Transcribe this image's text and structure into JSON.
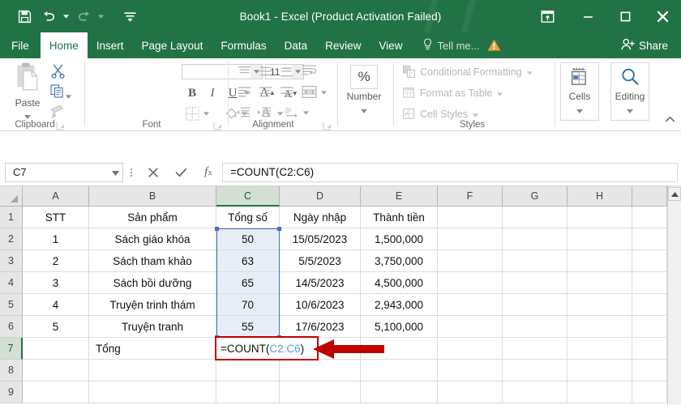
{
  "titlebar": {
    "document_title": "Book1 - Excel (Product Activation Failed)",
    "qat": [
      {
        "name": "save-icon",
        "label": "Save"
      },
      {
        "name": "undo-icon",
        "label": "Undo"
      },
      {
        "name": "redo-icon",
        "label": "Redo"
      },
      {
        "name": "customize-qat-icon",
        "label": "Customize Quick Access Toolbar"
      }
    ],
    "window_controls": [
      {
        "name": "ribbon-display-options-icon",
        "label": "Ribbon Display Options"
      },
      {
        "name": "minimize-icon",
        "label": "Minimize"
      },
      {
        "name": "restore-icon",
        "label": "Restore Down"
      },
      {
        "name": "close-icon",
        "label": "Close"
      }
    ]
  },
  "tabs": [
    {
      "label": "File",
      "active": false
    },
    {
      "label": "Home",
      "active": true
    },
    {
      "label": "Insert",
      "active": false
    },
    {
      "label": "Page Layout",
      "active": false
    },
    {
      "label": "Formulas",
      "active": false
    },
    {
      "label": "Data",
      "active": false
    },
    {
      "label": "Review",
      "active": false
    },
    {
      "label": "View",
      "active": false
    }
  ],
  "tellme": {
    "label": "Tell me...",
    "icon": "lightbulb-icon"
  },
  "warning": {
    "icon": "warning-triangle-icon",
    "color": "#e8a33d"
  },
  "share": {
    "label": "Share",
    "icon": "share-person-icon"
  },
  "ribbon": {
    "groups": [
      {
        "label": "Clipboard"
      },
      {
        "label": "Font"
      },
      {
        "label": "Alignment"
      },
      {
        "label": "Number"
      },
      {
        "label": "Styles"
      }
    ],
    "clipboard": {
      "paste_label": "Paste",
      "cut_label": "Cut",
      "copy_label": "Copy",
      "format_painter_label": "Format Painter"
    },
    "font": {
      "font_name_value": "",
      "font_name_placeholder": "",
      "font_size_value": "11",
      "bold_label": "B",
      "italic_label": "I",
      "underline_label": "U",
      "grow_font_label": "A",
      "shrink_font_label": "A",
      "borders_label": "Borders",
      "fill_color_label": "Fill Color",
      "font_color_label": "A"
    },
    "number": {
      "label": "Number",
      "format_icon": "percent-icon",
      "format_symbol": "%"
    },
    "styles": {
      "conditional_formatting": "Conditional Formatting",
      "format_as_table": "Format as Table",
      "cell_styles": "Cell Styles"
    },
    "cells": {
      "label": "Cells",
      "icon": "insert-cells-icon"
    },
    "editing": {
      "label": "Editing",
      "icon": "find-magnifier-icon"
    }
  },
  "formula_bar": {
    "name_box_value": "C7",
    "cancel_icon": "cancel-x-icon",
    "enter_icon": "enter-check-icon",
    "insert_function_icon": "fx-icon",
    "formula_value": "=COUNT(C2:C6)"
  },
  "grid": {
    "columns": [
      "A",
      "B",
      "C",
      "D",
      "E",
      "F",
      "G",
      "H"
    ],
    "selected_column": "C",
    "rows": [
      "1",
      "2",
      "3",
      "4",
      "5",
      "6",
      "7",
      "8",
      "9"
    ],
    "selected_row": "7",
    "data": [
      {
        "A": "STT",
        "B": "Sản phẩm",
        "C": "Tổng số",
        "D": "Ngày nhập",
        "E": "Thành tiền"
      },
      {
        "A": "1",
        "B": "Sách giáo khóa",
        "C": "50",
        "D": "15/05/2023",
        "E": "1,500,000"
      },
      {
        "A": "2",
        "B": "Sách tham khảo",
        "C": "63",
        "D": "5/5/2023",
        "E": "3,750,000"
      },
      {
        "A": "3",
        "B": "Sách bồi dưỡng",
        "C": "65",
        "D": "14/5/2023",
        "E": "4,500,000"
      },
      {
        "A": "4",
        "B": "Truyện trinh thám",
        "C": "70",
        "D": "10/6/2023",
        "E": "2,943,000"
      },
      {
        "A": "5",
        "B": "Truyện tranh",
        "C": "55",
        "D": "17/6/2023",
        "E": "5,100,000"
      },
      {
        "A": "",
        "B": "Tổng",
        "C": "",
        "D": "",
        "E": ""
      },
      {
        "A": "",
        "B": "",
        "C": "",
        "D": "",
        "E": ""
      },
      {
        "A": "",
        "B": "",
        "C": "",
        "D": "",
        "E": ""
      }
    ],
    "active_cell": {
      "reference": "C7",
      "formula_prefix": "=COUNT(",
      "formula_range": "C2:C6",
      "formula_suffix": ")",
      "border_color": "#c00000"
    },
    "highlighted_range": {
      "reference": "C2:C6",
      "color": "#4472c4"
    },
    "annotation_arrow": {
      "name": "red-pointer-arrow",
      "color": "#c00000",
      "points_to": "C7"
    }
  }
}
